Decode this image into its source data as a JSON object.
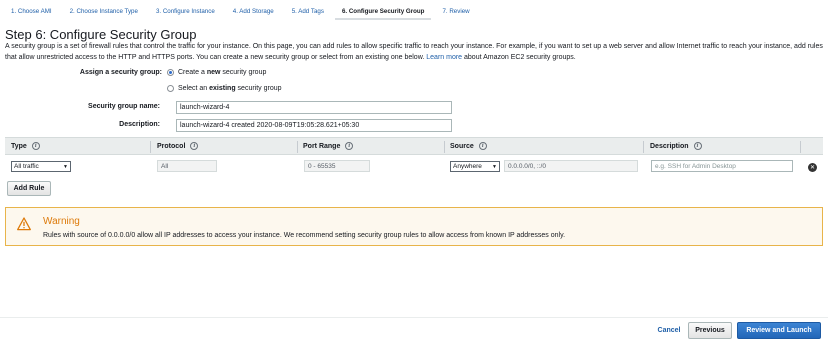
{
  "wizard": {
    "steps": [
      {
        "label": "1. Choose AMI"
      },
      {
        "label": "2. Choose Instance Type"
      },
      {
        "label": "3. Configure Instance"
      },
      {
        "label": "4. Add Storage"
      },
      {
        "label": "5. Add Tags"
      },
      {
        "label": "6. Configure Security Group",
        "active": true
      },
      {
        "label": "7. Review"
      }
    ]
  },
  "page": {
    "title": "Step 6: Configure Security Group",
    "intro_text": "A security group is a set of firewall rules that control the traffic for your instance. On this page, you can add rules to allow specific traffic to reach your instance. For example, if you want to set up a web server and allow Internet traffic to reach your instance, add rules that allow unrestricted access to the HTTP and HTTPS ports. You can create a new security group or select from an existing one below.",
    "learn_more": "Learn more",
    "intro_suffix": "about Amazon EC2 security groups."
  },
  "form": {
    "assign_label": "Assign a security group:",
    "option_create_pre": "Create a",
    "option_create_bold": "new",
    "option_create_post": "security group",
    "option_existing_pre": "Select an",
    "option_existing_bold": "existing",
    "option_existing_post": "security group",
    "name_label": "Security group name:",
    "name_value": "launch-wizard-4",
    "description_label": "Description:",
    "description_value": "launch-wizard-4 created 2020-08-09T19:05:28.621+05:30"
  },
  "rules_table": {
    "headers": {
      "type": "Type",
      "protocol": "Protocol",
      "port_range": "Port Range",
      "source": "Source",
      "description": "Description"
    },
    "info_glyph": "i",
    "rows": [
      {
        "type": "All traffic",
        "protocol": "All",
        "port_range": "0 - 65535",
        "source_type": "Anywhere",
        "source_cidr": "0.0.0.0/0, ::/0",
        "description_placeholder": "e.g. SSH for Admin Desktop",
        "remove_glyph": "✕"
      }
    ],
    "add_rule_label": "Add Rule"
  },
  "warning": {
    "title": "Warning",
    "text": "Rules with source of 0.0.0.0/0 allow all IP addresses to access your instance. We recommend setting security group rules to allow access from known IP addresses only.",
    "icon": "warning-triangle-icon",
    "color": "#dd7a0a"
  },
  "footer": {
    "cancel_label": "Cancel",
    "previous_label": "Previous",
    "review_launch_label": "Review and Launch"
  },
  "colors": {
    "link": "#1f5fa8",
    "primary_button": "#2266b8",
    "warning_border": "#e8b44a"
  }
}
